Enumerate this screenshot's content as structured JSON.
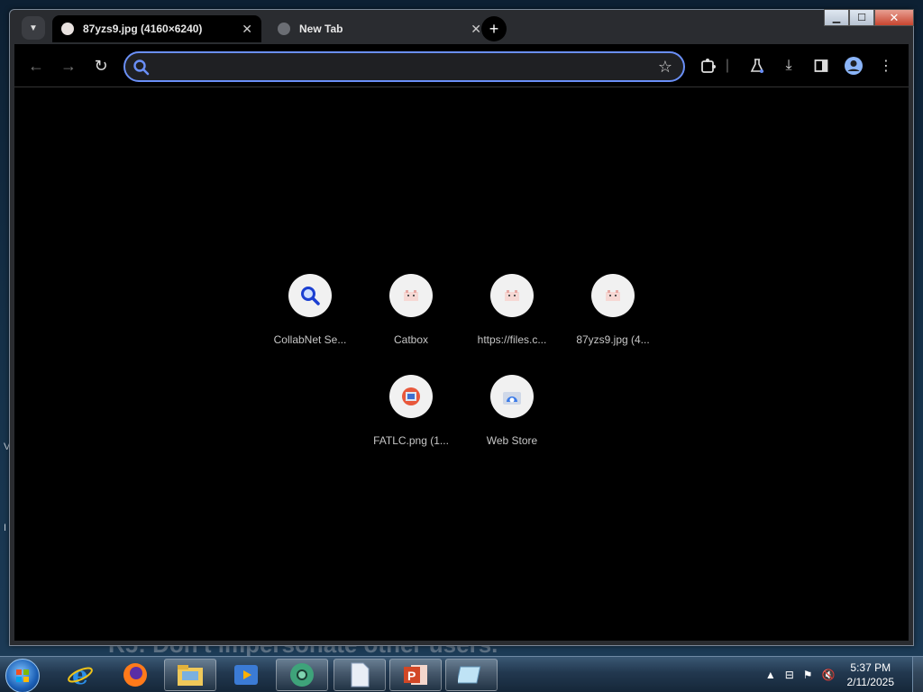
{
  "browser": {
    "tabs": [
      {
        "title": "87yzs9.jpg (4160×6240)",
        "active": true,
        "favicon": "pixel-cat-icon"
      },
      {
        "title": "New Tab",
        "active": false,
        "favicon": "globe-icon"
      }
    ],
    "new_tab_label": "+",
    "window_controls": {
      "minimize": "▁",
      "maximize": "☐",
      "close": "✕"
    },
    "omnibox": {
      "value": "",
      "placeholder": ""
    },
    "accent_color": "#6a8ff7"
  },
  "new_tab_page": {
    "shortcuts": [
      {
        "label": "CollabNet Se...",
        "icon": "search-magnifier-icon"
      },
      {
        "label": "Catbox",
        "icon": "pixel-cat-icon"
      },
      {
        "label": "https://files.c...",
        "icon": "pixel-cat-icon"
      },
      {
        "label": "87yzs9.jpg (4...",
        "icon": "pixel-cat-icon"
      },
      {
        "label": "FATLC.png (1...",
        "icon": "image-icon"
      },
      {
        "label": "Web Store",
        "icon": "web-store-icon"
      }
    ]
  },
  "desktop": {
    "background_text": "R5: Don't impersonate other users.",
    "left_fragments": [
      "V",
      "I"
    ]
  },
  "taskbar": {
    "clock_time": "5:37 PM",
    "clock_date": "2/11/2025",
    "pinned": [
      "internet-explorer-icon",
      "firefox-icon",
      "file-explorer-icon",
      "media-player-icon",
      "chrome-icon",
      "document-icon",
      "powerpoint-icon",
      "snipping-tool-icon"
    ],
    "tray_icons": [
      "show-hidden-icons-icon",
      "network-icon",
      "action-center-flag-icon",
      "volume-muted-icon"
    ]
  }
}
